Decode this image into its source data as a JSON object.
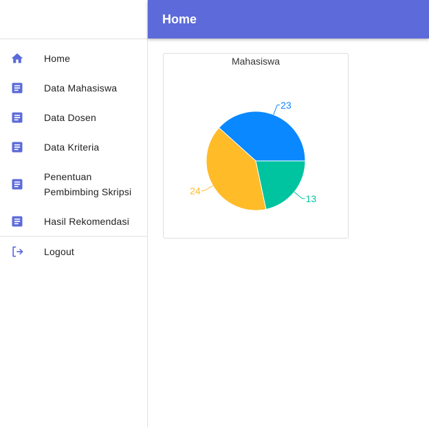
{
  "header": {
    "title": "Home"
  },
  "sidebar": {
    "items": [
      {
        "label": "Home",
        "icon": "home-icon"
      },
      {
        "label": "Data Mahasiswa",
        "icon": "document-icon"
      },
      {
        "label": "Data Dosen",
        "icon": "document-icon"
      },
      {
        "label": "Data Kriteria",
        "icon": "document-icon"
      },
      {
        "label_line1": "Penentuan",
        "label_line2": "Pembimbing Skripsi",
        "icon": "document-icon"
      },
      {
        "label": "Hasil Rekomendasi",
        "icon": "document-icon"
      }
    ],
    "logout": {
      "label": "Logout",
      "icon": "logout-icon"
    }
  },
  "colors": {
    "accent": "#5c6bd9",
    "series": [
      "#0a88ff",
      "#ffbb28",
      "#00c49f"
    ]
  },
  "chart_data": {
    "type": "pie",
    "title": "Mahasiswa",
    "values": [
      23,
      24,
      13
    ]
  }
}
